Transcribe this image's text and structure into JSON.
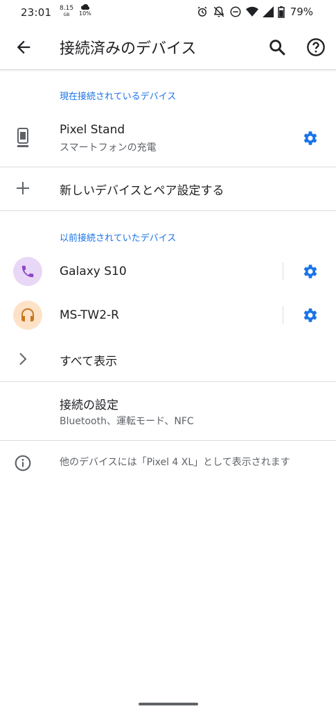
{
  "status_bar": {
    "time": "23:01",
    "data_speed_value": "8.15",
    "data_speed_unit": "GB",
    "weather_percent": "10%",
    "battery_percent": "79%"
  },
  "app_bar": {
    "title": "接続済みのデバイス"
  },
  "current_section": {
    "label": "現在接続されているデバイス",
    "devices": [
      {
        "name": "Pixel Stand",
        "subtitle": "スマートフォンの充電",
        "icon": "phone-stand-icon"
      }
    ]
  },
  "pair_new": {
    "label": "新しいデバイスとペア設定する"
  },
  "previous_section": {
    "label": "以前接続されていたデバイス",
    "devices": [
      {
        "name": "Galaxy S10",
        "icon": "phone-icon",
        "icon_bg": "#e9d7f7",
        "icon_color": "#8e47c9"
      },
      {
        "name": "MS-TW2-R",
        "icon": "headset-icon",
        "icon_bg": "#fde2c7",
        "icon_color": "#c8761e"
      }
    ],
    "see_all_label": "すべて表示"
  },
  "connection_prefs": {
    "title": "接続の設定",
    "subtitle": "Bluetooth、運転モード、NFC"
  },
  "info": {
    "text": "他のデバイスには「Pixel 4 XL」として表示されます"
  },
  "colors": {
    "accent": "#1a73e8",
    "text_primary": "#202124",
    "text_secondary": "#5f6368",
    "divider": "#dadce0"
  }
}
